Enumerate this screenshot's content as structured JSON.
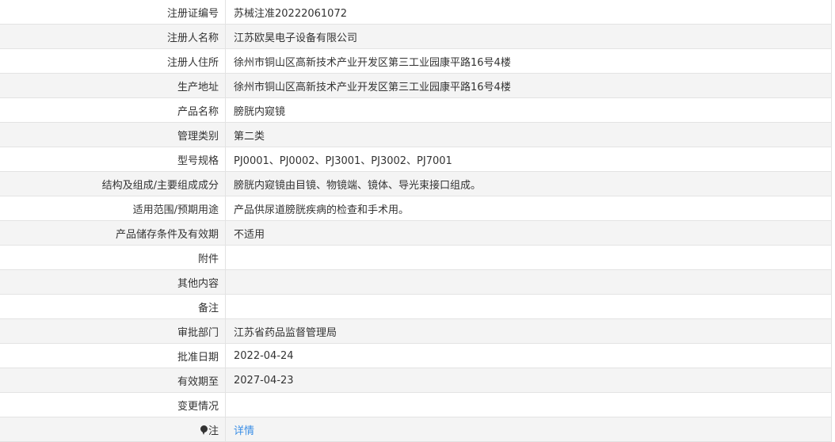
{
  "record": {
    "rows": [
      {
        "label": "注册证编号",
        "value": "苏械注准20222061072"
      },
      {
        "label": "注册人名称",
        "value": "江苏欧昊电子设备有限公司"
      },
      {
        "label": "注册人住所",
        "value": "徐州市铜山区高新技术产业开发区第三工业园康平路16号4楼"
      },
      {
        "label": "生产地址",
        "value": "徐州市铜山区高新技术产业开发区第三工业园康平路16号4楼"
      },
      {
        "label": "产品名称",
        "value": "膀胱内窥镜"
      },
      {
        "label": "管理类别",
        "value": "第二类"
      },
      {
        "label": "型号规格",
        "value": "PJ0001、PJ0002、PJ3001、PJ3002、PJ7001"
      },
      {
        "label": "结构及组成/主要组成成分",
        "value": "膀胱内窥镜由目镜、物镜端、镜体、导光束接口组成。"
      },
      {
        "label": "适用范围/预期用途",
        "value": "产品供尿道膀胱疾病的检查和手术用。"
      },
      {
        "label": "产品储存条件及有效期",
        "value": "不适用"
      },
      {
        "label": "附件",
        "value": ""
      },
      {
        "label": "其他内容",
        "value": ""
      },
      {
        "label": "备注",
        "value": ""
      },
      {
        "label": "审批部门",
        "value": "江苏省药品监督管理局"
      },
      {
        "label": "批准日期",
        "value": "2022-04-24"
      },
      {
        "label": "有效期至",
        "value": "2027-04-23"
      },
      {
        "label": "变更情况",
        "value": ""
      }
    ],
    "note": {
      "icon": "pin-icon",
      "label": "注",
      "link_text": "详情"
    }
  }
}
